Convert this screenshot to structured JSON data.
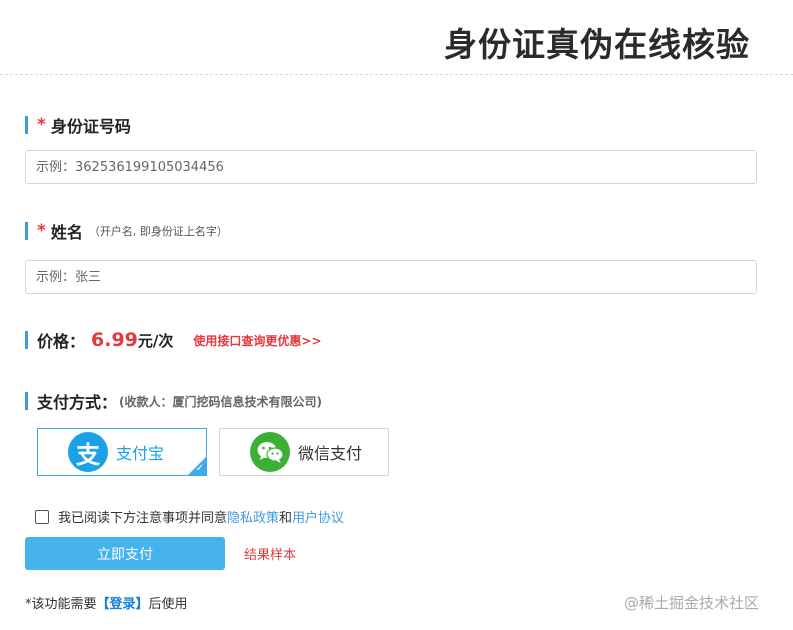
{
  "header": {
    "title": "身份证真伪在线核验"
  },
  "id_field": {
    "required_mark": "*",
    "label": "身份证号码",
    "placeholder": "示例：362536199105034456"
  },
  "name_field": {
    "required_mark": "*",
    "label": "姓名",
    "hint": "（开户名, 即身份证上名字）",
    "placeholder": "示例：张三"
  },
  "price": {
    "label": "价格：",
    "value": "6.99",
    "unit": "元/次",
    "api_link": "使用接口查询更优惠>>"
  },
  "payment": {
    "label": "支付方式：",
    "payee": "(收款人：厦门挖码信息技术有限公司)",
    "options": [
      {
        "label": "支付宝",
        "icon": "alipay-icon",
        "glyph": "支",
        "selected": true
      },
      {
        "label": "微信支付",
        "icon": "wechat-icon",
        "selected": false
      }
    ],
    "selected_check": "✓"
  },
  "agreement": {
    "text": "我已阅读下方注意事项并同意",
    "privacy_link": "隐私政策",
    "and": "和",
    "user_agreement_link": "用户协议",
    "checked": false
  },
  "actions": {
    "pay_button": "立即支付",
    "sample_link": "结果样本"
  },
  "footer": {
    "note_prefix": "*该功能需要",
    "login_link": "【登录】",
    "note_suffix": "后使用"
  },
  "watermark": "@稀土掘金技术社区",
  "colors": {
    "accent_blue": "#46b3ee",
    "alipay_blue": "#1aa1e8",
    "wechat_green": "#3cb035",
    "price_red": "#e4393c",
    "label_bar": "#3e9bdc"
  }
}
